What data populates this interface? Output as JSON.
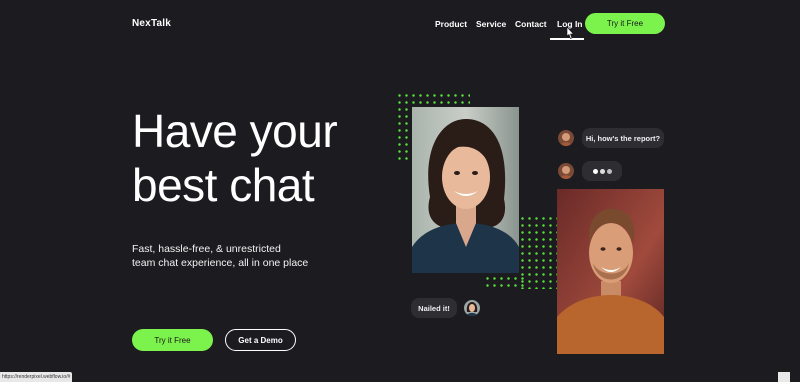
{
  "nav": {
    "logo": "NexTalk",
    "links": [
      "Product",
      "Service",
      "Contact",
      "Log In"
    ],
    "cta": "Try it Free"
  },
  "hero": {
    "title_line1": "Have your",
    "title_line2": "best chat",
    "subtitle_line1": "Fast, hassle-free, & unrestricted",
    "subtitle_line2": "team chat experience, all in one place",
    "primary_button": "Try it Free",
    "secondary_button": "Get a Demo"
  },
  "chat": {
    "message1": "Hi, how's the report?",
    "message2": "Nailed it!"
  },
  "status_bar": {
    "url": "https://renderpixel.webflow.io/#"
  },
  "colors": {
    "background": "#1c1b1f",
    "accent": "#7cf24d",
    "bubble": "#2e2d31"
  },
  "icons": [
    "cursor-icon",
    "typing-indicator-icon"
  ]
}
